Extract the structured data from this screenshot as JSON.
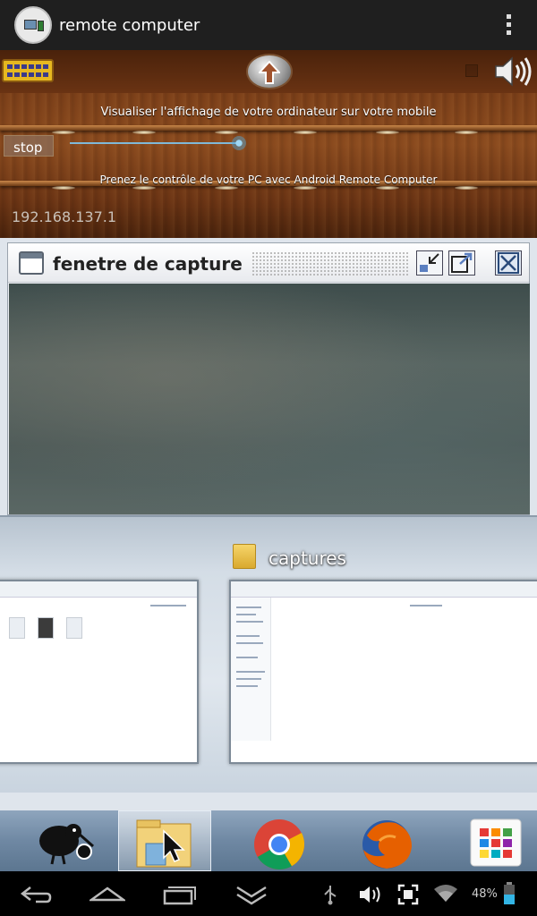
{
  "app": {
    "title": "remote computer"
  },
  "panel": {
    "line1": "Visualiser l'affichage de votre ordinateur sur votre mobile",
    "stop_label": "stop",
    "slider_value": 0.95,
    "line2": "Prenez le contrôle de votre PC avec Android Remote Computer",
    "ip": "192.168.137.1"
  },
  "remote_screen": {
    "capture_window_title": "fenetre de capture",
    "folder_label": "captures",
    "taskbar_items": [
      "kiwi-app-icon",
      "file-explorer-icon",
      "chrome-icon",
      "firefox-icon",
      "apps-grid-icon"
    ]
  },
  "status": {
    "battery_percent": "48%"
  },
  "colors": {
    "wood": "#7a3e18",
    "accent_blue": "#7fb9d8"
  }
}
